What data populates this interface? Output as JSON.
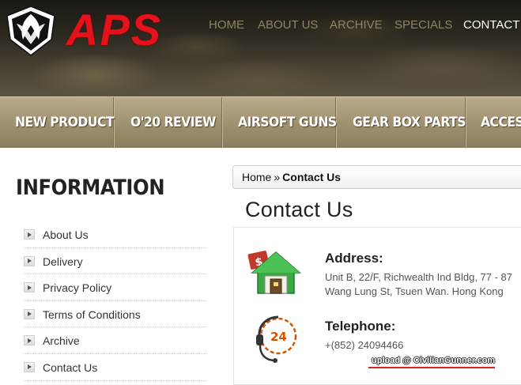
{
  "brand": {
    "name": "APS",
    "accent_color": "#e3121b"
  },
  "top_nav": [
    {
      "label": "HOME"
    },
    {
      "label": "ABOUT US"
    },
    {
      "label": "ARCHIVE"
    },
    {
      "label": "SPECIALS"
    },
    {
      "label": "CONTACT U"
    }
  ],
  "category_bar": [
    {
      "label": "NEW PRODUCT"
    },
    {
      "label": "O'20 REVIEW"
    },
    {
      "label": "AIRSOFT GUNS"
    },
    {
      "label": "GEAR BOX PARTS"
    },
    {
      "label": "ACCESS"
    }
  ],
  "sidebar": {
    "heading": "INFORMATION",
    "items": [
      {
        "label": "About Us",
        "icon": "arrow-right-icon"
      },
      {
        "label": "Delivery",
        "icon": "arrow-right-icon"
      },
      {
        "label": "Privacy Policy",
        "icon": "arrow-right-icon"
      },
      {
        "label": "Terms of Conditions",
        "icon": "arrow-right-icon"
      },
      {
        "label": "Archive",
        "icon": "arrow-right-icon"
      },
      {
        "label": "Contact Us",
        "icon": "arrow-right-icon"
      }
    ]
  },
  "breadcrumb": {
    "home": "Home",
    "separator": "»",
    "current": "Contact Us"
  },
  "main": {
    "title": "Contact Us",
    "address": {
      "title": "Address:",
      "line1": "Unit B, 22/F, Richwealth Ind Bldg, 77 - 87",
      "line2": "Wang Lung St, Tsuen Wan. Hong Kong",
      "icon": "house-icon"
    },
    "telephone": {
      "title": "Telephone:",
      "number": "+(852) 24094466",
      "icon": "phone-24-icon",
      "icon_text": "24"
    }
  },
  "watermark": "upload @ CivilianGunner.com"
}
